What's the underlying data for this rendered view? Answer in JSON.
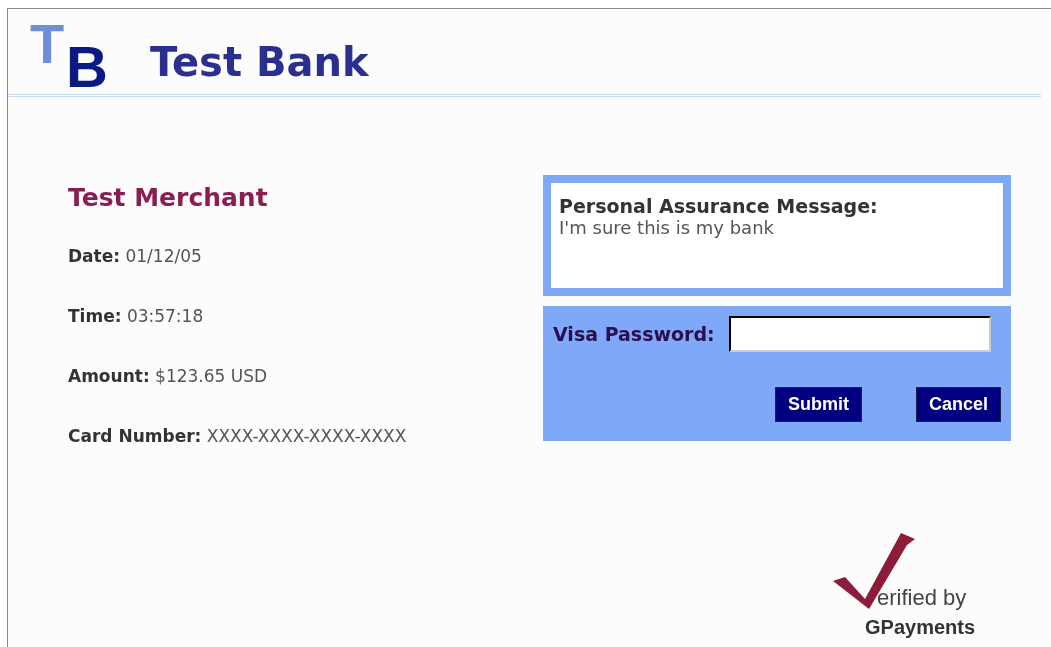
{
  "header": {
    "logo_letters": [
      "T",
      "B"
    ],
    "title": "Test Bank"
  },
  "merchant": {
    "name": "Test Merchant",
    "details": [
      {
        "label": "Date:",
        "value": "01/12/05"
      },
      {
        "label": "Time:",
        "value": "03:57:18"
      },
      {
        "label": "Amount:",
        "value": "$123.65 USD"
      },
      {
        "label": "Card Number:",
        "value": "XXXX-XXXX-XXXX-XXXX"
      }
    ]
  },
  "assurance": {
    "label": "Personal Assurance Message:",
    "message": "I'm sure this is my bank"
  },
  "password": {
    "label": "Visa Password:"
  },
  "buttons": [
    "Submit",
    "Cancel"
  ],
  "footer_logo": {
    "line1": "erified by",
    "line2": "GPayments"
  }
}
